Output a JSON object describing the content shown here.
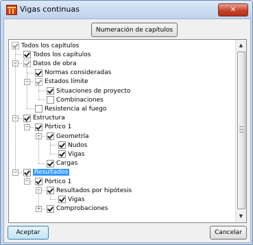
{
  "window": {
    "title": "Vigas continuas",
    "close_label": "✕"
  },
  "toolbar": {
    "chapters_button": "Numeración de capítulos"
  },
  "tree": [
    {
      "label": "Todos los capítulos",
      "level": 0,
      "state": "grey-checked",
      "expander": null
    },
    {
      "label": "Todos los capítulos",
      "level": 1,
      "state": "checked",
      "expander": null
    },
    {
      "label": "Datos de obra",
      "level": 1,
      "state": "grey-checked",
      "expander": "-"
    },
    {
      "label": "Normas consideradas",
      "level": 2,
      "state": "checked",
      "expander": null
    },
    {
      "label": "Estados límite",
      "level": 2,
      "state": "grey-checked",
      "expander": "-"
    },
    {
      "label": "Situaciones de proyecto",
      "level": 3,
      "state": "checked",
      "expander": null
    },
    {
      "label": "Combinaciones",
      "level": 3,
      "state": "unchecked",
      "expander": null
    },
    {
      "label": "Resistencia al fuego",
      "level": 2,
      "state": "unchecked",
      "expander": null
    },
    {
      "label": "Estructura",
      "level": 1,
      "state": "checked",
      "expander": "-"
    },
    {
      "label": "Pórtico 1",
      "level": 2,
      "state": "checked",
      "expander": "-"
    },
    {
      "label": "Geometría",
      "level": 3,
      "state": "checked",
      "expander": "-"
    },
    {
      "label": "Nudos",
      "level": 4,
      "state": "checked",
      "expander": null
    },
    {
      "label": "Vigas",
      "level": 4,
      "state": "checked",
      "expander": null
    },
    {
      "label": "Cargas",
      "level": 3,
      "state": "checked",
      "expander": null
    },
    {
      "label": "Resultados",
      "level": 1,
      "state": "checked",
      "expander": "-",
      "selected": true
    },
    {
      "label": "Pórtico 1",
      "level": 2,
      "state": "checked",
      "expander": "-"
    },
    {
      "label": "Resultados por hipótesis",
      "level": 3,
      "state": "checked",
      "expander": "-"
    },
    {
      "label": "Vigas",
      "level": 4,
      "state": "checked",
      "expander": null
    },
    {
      "label": "Comprobaciones",
      "level": 3,
      "state": "checked",
      "expander": "+"
    }
  ],
  "footer": {
    "accept_label": "Aceptar",
    "cancel_label": "Cancelar"
  },
  "icons": {
    "app": "beam-app-icon",
    "close": "close-icon",
    "scroll_up": "scroll-up-arrow-icon",
    "scroll_down": "scroll-down-arrow-icon"
  },
  "colors": {
    "selection": "#3399ff",
    "titlebar": "#c4d7ee",
    "close": "#c7432b"
  }
}
